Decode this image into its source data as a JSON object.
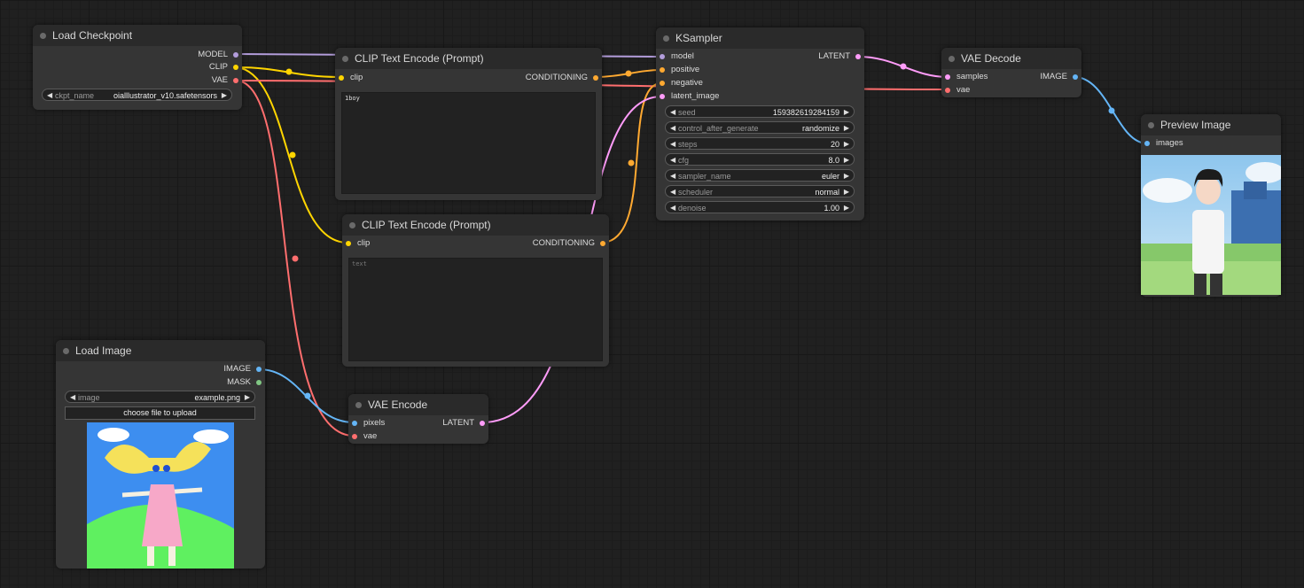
{
  "colors": {
    "model": "#b39ddb",
    "clip": "#ffd500",
    "vae": "#ff6e6e",
    "conditioning": "#ffa931",
    "latent": "#ff9cf9",
    "image": "#64b5f6",
    "mask": "#81c784"
  },
  "nodes": {
    "load_checkpoint": {
      "title": "Load Checkpoint",
      "outputs": [
        "MODEL",
        "CLIP",
        "VAE"
      ],
      "ckpt_label": "ckpt_name",
      "ckpt_value": "oialllustrator_v10.safetensors"
    },
    "clip_pos": {
      "title": "CLIP Text Encode (Prompt)",
      "input": "clip",
      "output": "CONDITIONING",
      "text": "1boy"
    },
    "clip_neg": {
      "title": "CLIP Text Encode (Prompt)",
      "input": "clip",
      "output": "CONDITIONING",
      "placeholder": "text"
    },
    "ksampler": {
      "title": "KSampler",
      "inputs": [
        "model",
        "positive",
        "negative",
        "latent_image"
      ],
      "output": "LATENT",
      "widgets": [
        {
          "label": "seed",
          "value": "159382619284159"
        },
        {
          "label": "control_after_generate",
          "value": "randomize"
        },
        {
          "label": "steps",
          "value": "20"
        },
        {
          "label": "cfg",
          "value": "8.0"
        },
        {
          "label": "sampler_name",
          "value": "euler"
        },
        {
          "label": "scheduler",
          "value": "normal"
        },
        {
          "label": "denoise",
          "value": "1.00"
        }
      ]
    },
    "vae_decode": {
      "title": "VAE Decode",
      "inputs": [
        "samples",
        "vae"
      ],
      "output": "IMAGE"
    },
    "preview": {
      "title": "Preview Image",
      "input": "images"
    },
    "load_image": {
      "title": "Load Image",
      "outputs": [
        "IMAGE",
        "MASK"
      ],
      "image_label": "image",
      "image_value": "example.png",
      "upload_label": "choose file to upload"
    },
    "vae_encode": {
      "title": "VAE Encode",
      "inputs": [
        "pixels",
        "vae"
      ],
      "output": "LATENT"
    }
  }
}
